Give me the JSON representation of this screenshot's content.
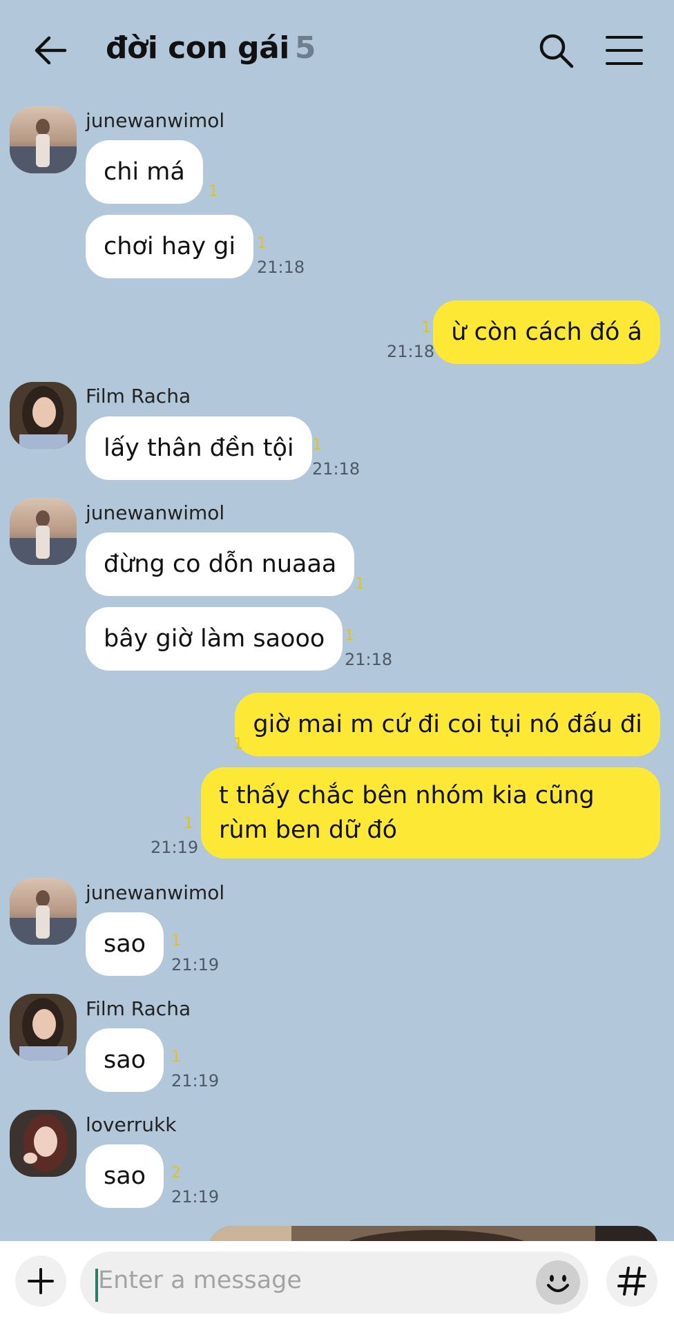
{
  "header": {
    "title": "đời con gái",
    "member_count": "5"
  },
  "messages": [
    {
      "sender": "junewanwimol",
      "text": "chi má",
      "unread": "1"
    },
    {
      "text": "chơi hay gi",
      "unread": "1",
      "time": "21:18"
    },
    {
      "text": "ừ còn cách đó á",
      "unread": "1",
      "time": "21:18",
      "outgoing": true
    },
    {
      "sender": "Film Racha",
      "text": "lấy thân đền tội",
      "unread": "1",
      "time": "21:18"
    },
    {
      "sender": "junewanwimol",
      "text": "đừng co dỗn nuaaa",
      "unread": "1"
    },
    {
      "text": "bây giờ làm saooo",
      "unread": "1",
      "time": "21:18"
    },
    {
      "text": "giờ mai m cứ đi coi tụi nó đấu đi",
      "unread": "1",
      "outgoing": true
    },
    {
      "text": "t thấy chắc bên nhóm kia cũng rùm ben dữ đó",
      "unread": "1",
      "time": "21:19",
      "outgoing": true
    },
    {
      "sender": "junewanwimol",
      "text": "sao",
      "unread": "1",
      "time": "21:19"
    },
    {
      "sender": "Film Racha",
      "text": "sao",
      "unread": "1",
      "time": "21:19"
    },
    {
      "sender": "loverrukk",
      "text": "sao",
      "unread": "2",
      "time": "21:19"
    }
  ],
  "input": {
    "placeholder": "Enter a message"
  },
  "icons": {
    "back": "arrow-left-icon",
    "search": "search-icon",
    "menu": "hamburger-menu-icon",
    "plus": "plus-icon",
    "emoji": "emoji-icon",
    "hash": "hash-icon"
  },
  "colors": {
    "background": "#b2c7da",
    "outgoing_bubble": "#fde935",
    "incoming_bubble": "#ffffff",
    "unread_count": "#e2c21e"
  }
}
